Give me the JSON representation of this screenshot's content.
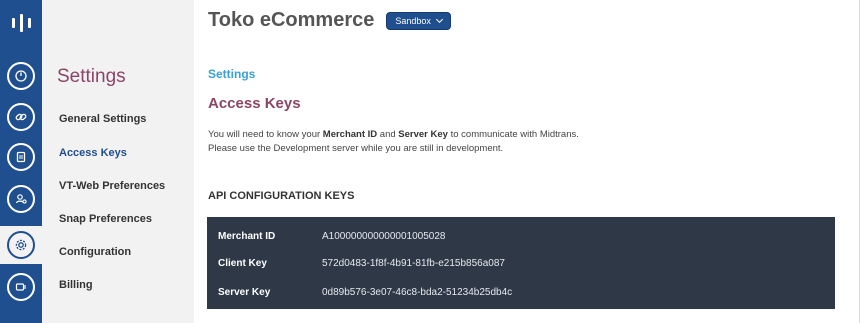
{
  "app": {
    "title": "Toko eCommerce",
    "environment_selector": "Sandbox"
  },
  "sidebar_rail": {
    "icons": [
      "logo-icon",
      "dashboard-gauge-icon",
      "link-icon",
      "document-icon",
      "users-icon",
      "settings-gear-icon",
      "payment-icon"
    ]
  },
  "subnav": {
    "heading": "Settings",
    "items": [
      {
        "label": "General Settings"
      },
      {
        "label": "Access Keys"
      },
      {
        "label": "VT-Web Preferences"
      },
      {
        "label": "Snap Preferences"
      },
      {
        "label": "Configuration"
      },
      {
        "label": "Billing"
      }
    ]
  },
  "main": {
    "breadcrumb": "Settings",
    "page_title": "Access Keys",
    "description": {
      "line1_prefix": "You will need to know your ",
      "merchant_id_term": "Merchant ID",
      "and": " and ",
      "server_key_term": "Server Key",
      "line1_suffix": " to communicate with Midtrans.",
      "line2": "Please use the Development server while you are still in development."
    },
    "section_heading": "API CONFIGURATION KEYS",
    "keys": [
      {
        "label": "Merchant ID",
        "value": "A100000000000001005028"
      },
      {
        "label": "Client Key",
        "value": "572d0483-1f8f-4b91-81fb-e215b856a087"
      },
      {
        "label": "Server Key",
        "value": "0d89b576-3e07-46c8-bda2-51234b25db4c"
      }
    ]
  },
  "colors": {
    "rail": "#1f4f8f",
    "heading_accent": "#8b4566",
    "breadcrumb": "#3aa0d6",
    "keys_panel": "#2e3846"
  }
}
